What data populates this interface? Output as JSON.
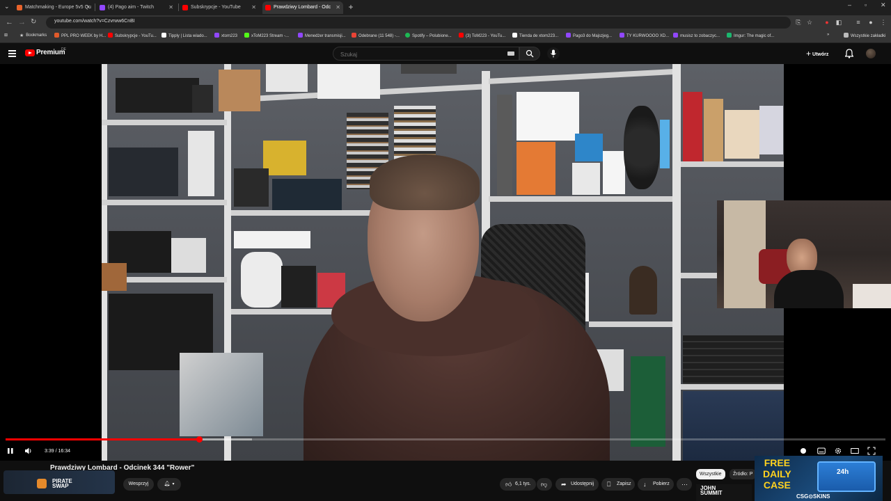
{
  "browser": {
    "tabs": [
      {
        "title": "Matchmaking - Europe 5v5 Qu",
        "color": "#e8632b",
        "active": false
      },
      {
        "title": "(4) Pago aim - Twitch",
        "color": "#9147ff",
        "active": false
      },
      {
        "title": "Subskrypcje - YouTube",
        "color": "#ff0000",
        "active": false
      },
      {
        "title": "Prawdziwy Lombard - Odc",
        "color": "#ff0000",
        "active": true
      }
    ],
    "url": "youtube.com/watch?v=Czvrww6CnBI",
    "bookmarks": [
      {
        "label": "Bookmarks",
        "color": "#cccccc"
      },
      {
        "label": "PPL PRO WEEK by H...",
        "color": "#e05a2a"
      },
      {
        "label": "Subskrypcje - YouTu...",
        "color": "#ff0000"
      },
      {
        "label": "Tipply | Lista wiado...",
        "color": "#ffffff"
      },
      {
        "label": "xtom223",
        "color": "#9147ff"
      },
      {
        "label": "xToM223 Stream -...",
        "color": "#53fc18"
      },
      {
        "label": "Menedżer transmisji...",
        "color": "#9147ff"
      },
      {
        "label": "Odebrane (11 548) -...",
        "color": "#ea4335"
      },
      {
        "label": "Spotify – Polubione...",
        "color": "#1db954"
      },
      {
        "label": "(3) ToM223 - YouTu...",
        "color": "#ff0000"
      },
      {
        "label": "Tienda de xtom223...",
        "color": "#ffffff"
      },
      {
        "label": "Pago3 do Majszjeg...",
        "color": "#9147ff"
      },
      {
        "label": "TY KURWOOOO XD...",
        "color": "#9147ff"
      },
      {
        "label": "musisz to zobaczyc...",
        "color": "#9147ff"
      },
      {
        "label": "Imgur: The magic of...",
        "color": "#1bb76e"
      }
    ],
    "bookmarks_all": "Wszystkie zakładki"
  },
  "youtube": {
    "brand": "Premium",
    "region": "DE",
    "search_placeholder": "Szukaj",
    "create_label": "Utwórz"
  },
  "player": {
    "time": "3:39 / 16:34",
    "progress_fraction": 0.22,
    "buffered_fraction": 0.28
  },
  "video": {
    "title": "Prawdziwy Lombard - Odcinek 344 \"Rower\"",
    "channel_logo_text": "PIRATE SWAP",
    "support_label": "Wesprzyj",
    "likes": "6,1 tys.",
    "share_label": "Udostępnij",
    "save_label": "Zapisz",
    "download_label": "Pobierz"
  },
  "chips": {
    "all": "Wszystkie",
    "source": "Źródło: P"
  },
  "overlay_ad": {
    "headline_1": "FREE",
    "headline_2": "DAILY",
    "headline_3": "CASE",
    "badge": "24h",
    "brand": "CSG⊙SKINS"
  },
  "thumb_john": "JOHN SUMMIT"
}
